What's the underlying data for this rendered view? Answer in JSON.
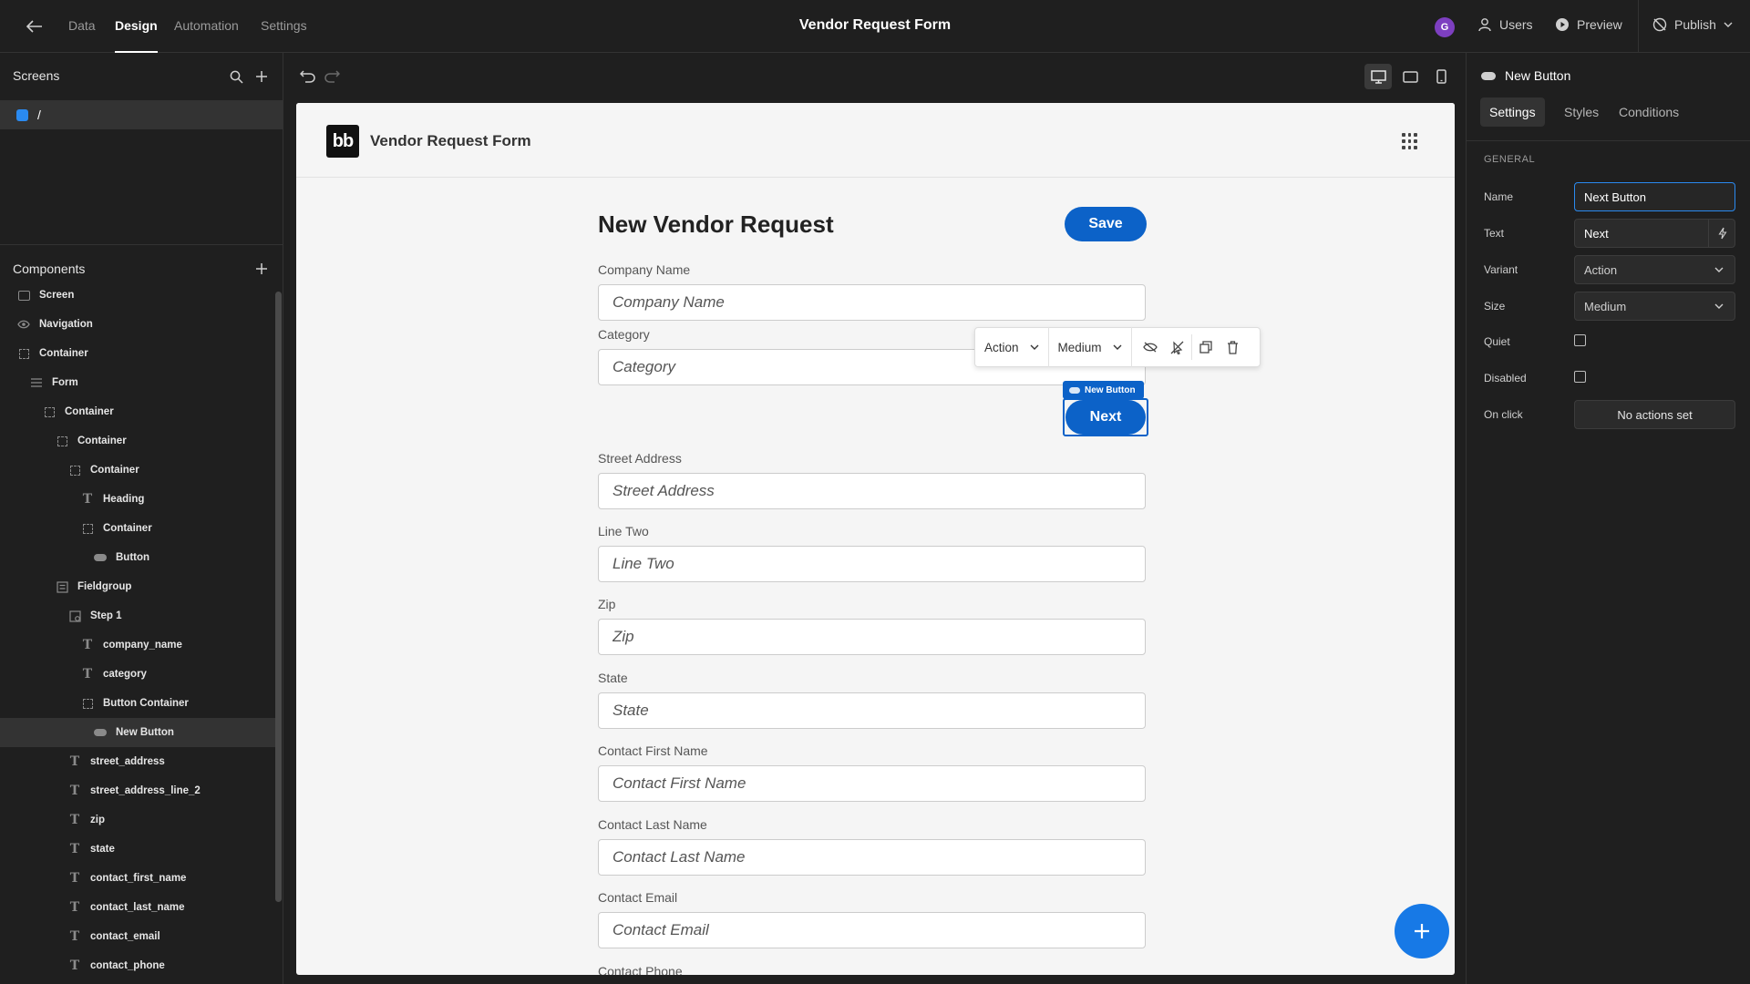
{
  "topbar": {
    "title": "Vendor Request Form",
    "tabs": [
      {
        "label": "Data",
        "active": false
      },
      {
        "label": "Design",
        "active": true
      },
      {
        "label": "Automation",
        "active": false
      },
      {
        "label": "Settings",
        "active": false
      }
    ],
    "avatar_initial": "G",
    "users_label": "Users",
    "preview_label": "Preview",
    "publish_label": "Publish"
  },
  "screens_panel": {
    "title": "Screens",
    "screens": [
      {
        "label": "/",
        "color": "#2a8af0"
      }
    ]
  },
  "components_panel": {
    "title": "Components",
    "tree": [
      {
        "label": "Screen",
        "icon": "screen-icon",
        "level": 0
      },
      {
        "label": "Navigation",
        "icon": "eye-icon",
        "level": 0
      },
      {
        "label": "Container",
        "icon": "container-icon",
        "level": 0
      },
      {
        "label": "Form",
        "icon": "form-icon",
        "level": 1
      },
      {
        "label": "Container",
        "icon": "container-icon",
        "level": 2
      },
      {
        "label": "Container",
        "icon": "container-icon",
        "level": 3
      },
      {
        "label": "Container",
        "icon": "container-icon",
        "level": 4
      },
      {
        "label": "Heading",
        "icon": "text-icon",
        "level": 5
      },
      {
        "label": "Container",
        "icon": "container-icon",
        "level": 5
      },
      {
        "label": "Button",
        "icon": "button-icon",
        "level": 6
      },
      {
        "label": "Fieldgroup",
        "icon": "fieldgroup-icon",
        "level": 3
      },
      {
        "label": "Step 1",
        "icon": "step-icon",
        "level": 4
      },
      {
        "label": "company_name",
        "icon": "text-icon",
        "level": 5
      },
      {
        "label": "category",
        "icon": "text-icon",
        "level": 5
      },
      {
        "label": "Button Container",
        "icon": "container-icon",
        "level": 5
      },
      {
        "label": "New Button",
        "icon": "button-icon",
        "level": 6,
        "selected": true
      },
      {
        "label": "street_address",
        "icon": "text-icon",
        "level": 4
      },
      {
        "label": "street_address_line_2",
        "icon": "text-icon",
        "level": 4
      },
      {
        "label": "zip",
        "icon": "text-icon",
        "level": 4
      },
      {
        "label": "state",
        "icon": "text-icon",
        "level": 4
      },
      {
        "label": "contact_first_name",
        "icon": "text-icon",
        "level": 4
      },
      {
        "label": "contact_last_name",
        "icon": "text-icon",
        "level": 4
      },
      {
        "label": "contact_email",
        "icon": "text-icon",
        "level": 4
      },
      {
        "label": "contact_phone",
        "icon": "text-icon",
        "level": 4
      }
    ]
  },
  "app_preview": {
    "logo_text": "bb",
    "brand_title": "Vendor Request Form",
    "heading": "New Vendor Request",
    "save_label": "Save",
    "fields": [
      {
        "label": "Company Name",
        "placeholder": "Company Name"
      },
      {
        "label": "Category",
        "placeholder": "Category"
      },
      {
        "label": "Street Address",
        "placeholder": "Street Address"
      },
      {
        "label": "Line Two",
        "placeholder": "Line Two"
      },
      {
        "label": "Zip",
        "placeholder": "Zip"
      },
      {
        "label": "State",
        "placeholder": "State"
      },
      {
        "label": "Contact First Name",
        "placeholder": "Contact First Name"
      },
      {
        "label": "Contact Last Name",
        "placeholder": "Contact Last Name"
      },
      {
        "label": "Contact Email",
        "placeholder": "Contact Email"
      },
      {
        "label": "Contact Phone",
        "placeholder": ""
      }
    ],
    "selected_component_tag": "New Button",
    "next_label": "Next",
    "floating_toolbar": {
      "variant": "Action",
      "size": "Medium"
    }
  },
  "settings_panel": {
    "component_title": "New Button",
    "tabs": [
      {
        "label": "Settings",
        "active": true
      },
      {
        "label": "Styles",
        "active": false
      },
      {
        "label": "Conditions",
        "active": false
      }
    ],
    "section": "GENERAL",
    "name_label": "Name",
    "name_value": "Next Button",
    "text_label": "Text",
    "text_value": "Next",
    "variant_label": "Variant",
    "variant_value": "Action",
    "size_label": "Size",
    "size_value": "Medium",
    "quiet_label": "Quiet",
    "quiet_checked": false,
    "disabled_label": "Disabled",
    "disabled_checked": false,
    "onclick_label": "On click",
    "onclick_value": "No actions set"
  },
  "colors": {
    "accent": "#0c62c8",
    "fab": "#1779e6",
    "panel_bg": "#1f1f1f",
    "avatar": "#7d3fc0"
  }
}
